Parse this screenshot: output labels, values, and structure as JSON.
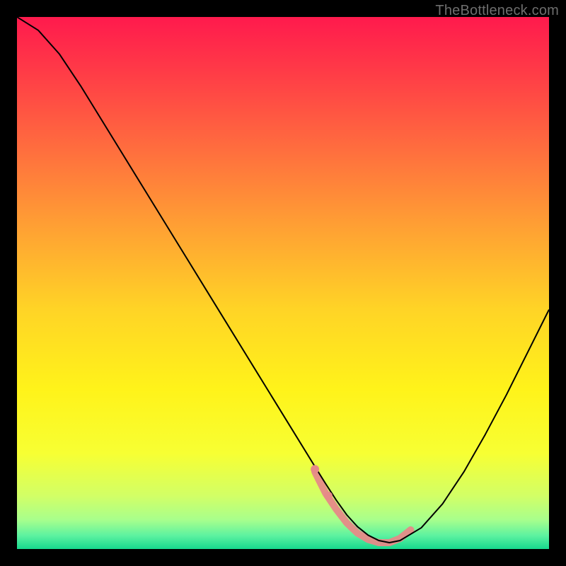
{
  "watermark": "TheBottleneck.com",
  "chart_data": {
    "type": "line",
    "title": "",
    "xlabel": "",
    "ylabel": "",
    "xlim": [
      0,
      100
    ],
    "ylim": [
      0,
      100
    ],
    "background_gradient": {
      "stops": [
        {
          "pos": 0.0,
          "color": "#ff1a4d"
        },
        {
          "pos": 0.1,
          "color": "#ff3a47"
        },
        {
          "pos": 0.25,
          "color": "#ff6e3e"
        },
        {
          "pos": 0.4,
          "color": "#ffa233"
        },
        {
          "pos": 0.55,
          "color": "#ffd426"
        },
        {
          "pos": 0.7,
          "color": "#fff31a"
        },
        {
          "pos": 0.82,
          "color": "#f7ff33"
        },
        {
          "pos": 0.9,
          "color": "#d2ff66"
        },
        {
          "pos": 0.945,
          "color": "#a8ff8c"
        },
        {
          "pos": 0.975,
          "color": "#5cf2a0"
        },
        {
          "pos": 1.0,
          "color": "#17d88e"
        }
      ]
    },
    "series": [
      {
        "name": "bottleneck-curve",
        "color": "#000000",
        "stroke_width": 2,
        "x": [
          0.0,
          4,
          8,
          12,
          16,
          20,
          24,
          28,
          32,
          36,
          40,
          44,
          48,
          52,
          56,
          58,
          60,
          62,
          64,
          66,
          68,
          70,
          72,
          76,
          80,
          84,
          88,
          92,
          96,
          100
        ],
        "y": [
          100,
          97.5,
          93,
          87,
          80.5,
          74,
          67.5,
          61,
          54.5,
          48,
          41.5,
          35,
          28.5,
          22,
          15.5,
          12.3,
          9.2,
          6.4,
          4.2,
          2.6,
          1.6,
          1.2,
          1.6,
          4.0,
          8.5,
          14.5,
          21.5,
          29,
          37,
          45
        ]
      }
    ],
    "highlight_span": {
      "comment": "light-red band along valley bottom",
      "color": "#e68a88",
      "stroke_width": 10,
      "x": [
        56,
        58,
        60,
        62,
        64,
        66,
        68,
        70,
        72,
        74
      ],
      "y": [
        14.5,
        10.5,
        7.5,
        4.9,
        3.0,
        1.8,
        1.2,
        1.2,
        2.0,
        3.6
      ]
    },
    "highlight_dots": {
      "color": "#e68a88",
      "radius": 6,
      "points": [
        {
          "x": 56.0,
          "y": 15.0
        },
        {
          "x": 58.5,
          "y": 10.0
        }
      ]
    }
  }
}
